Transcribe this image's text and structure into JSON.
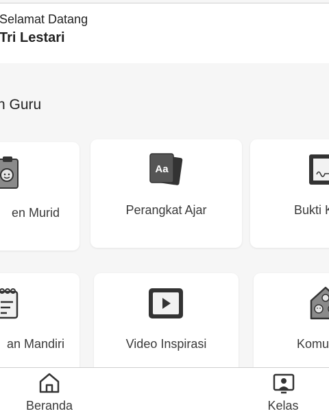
{
  "header": {
    "greeting": "Selamat Datang",
    "user_name": "Tri Lestari"
  },
  "section": {
    "title": "n Guru"
  },
  "menu": {
    "items": [
      {
        "label": "en Murid",
        "icon": "student-clipboard-icon"
      },
      {
        "label": "Perangkat Ajar",
        "icon": "book-icon"
      },
      {
        "label": "Bukti K",
        "icon": "certificate-icon"
      },
      {
        "label": "an Mandiri",
        "icon": "notepad-icon"
      },
      {
        "label": "Video Inspirasi",
        "icon": "video-play-icon"
      },
      {
        "label": "Komu",
        "icon": "community-house-icon"
      }
    ]
  },
  "bottom_nav": {
    "items": [
      {
        "label": "Beranda",
        "icon": "home-icon"
      },
      {
        "label": "Kelas",
        "icon": "classroom-icon"
      }
    ]
  },
  "colors": {
    "background": "#f6f6f6",
    "card": "#ffffff",
    "text": "#222222",
    "icon_dark": "#333333",
    "icon_mid": "#8a8a8a"
  }
}
